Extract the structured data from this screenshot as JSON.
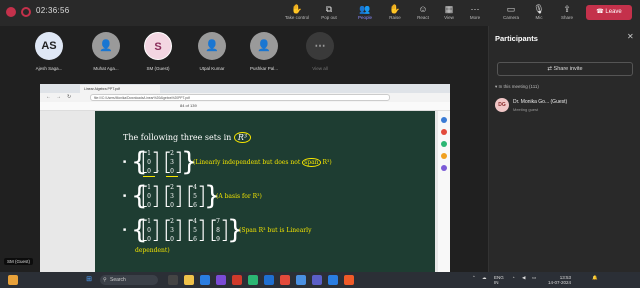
{
  "teams": {
    "timer": "02:36:56",
    "toolbar": [
      {
        "label": "Take control",
        "icon": "hand-icon"
      },
      {
        "label": "Pop out",
        "icon": "pop-out-icon"
      },
      {
        "label": "People",
        "icon": "people-icon"
      },
      {
        "label": "Raise",
        "icon": "raise-hand-icon"
      },
      {
        "label": "React",
        "icon": "react-icon"
      },
      {
        "label": "View",
        "icon": "view-icon"
      },
      {
        "label": "More",
        "icon": "more-icon"
      },
      {
        "label": "Camera",
        "icon": "camera-icon"
      },
      {
        "label": "Mic",
        "icon": "mic-icon"
      },
      {
        "label": "Share",
        "icon": "share-icon"
      }
    ],
    "leave_label": "Leave"
  },
  "participants_strip": [
    {
      "initials": "AS",
      "name": "Ajesh Saga...",
      "color": "#dfe7f5"
    },
    {
      "initials": "",
      "name": "Muhat Aga...",
      "color": "#9a9a9a"
    },
    {
      "initials": "S",
      "name": "SM (Guest)",
      "color": "#f3d6e2"
    },
    {
      "initials": "",
      "name": "Utpal Kumar",
      "color": "#9a9a9a"
    },
    {
      "initials": "",
      "name": "Pushkar Pal...",
      "color": "#9a9a9a"
    },
    {
      "initials": "",
      "name": "View all",
      "color": "#3a3a3a"
    }
  ],
  "panel": {
    "title": "Participants",
    "share_invite": "Share invite",
    "in_meeting": "In this meeting (111)",
    "person": {
      "initials": "DG",
      "name": "Dr. Monika Go...  (Guest)",
      "role": "Meeting guest"
    }
  },
  "browser": {
    "tab_title": "Linear Algebra PPT.pdf",
    "url": "file:///C:/Users/Monika/Downloads/Linear%20Algebra%20PPT.pdf",
    "pdf_info": "84  of 139"
  },
  "slide": {
    "title_text": "The following three sets in",
    "title_space": "R³",
    "rows": [
      {
        "vectors": [
          [
            "1",
            "0",
            "0"
          ],
          [
            "2",
            "3",
            "0"
          ]
        ],
        "caption": "(Linearly independent but does not",
        "caption_hl": "span",
        "caption_end": "R³)"
      },
      {
        "vectors": [
          [
            "1",
            "0",
            "0"
          ],
          [
            "2",
            "3",
            "0"
          ],
          [
            "4",
            "5",
            "6"
          ]
        ],
        "caption": "(A basis for R³)",
        "caption_hl": "",
        "caption_end": ""
      },
      {
        "vectors": [
          [
            "1",
            "0",
            "0"
          ],
          [
            "2",
            "3",
            "0"
          ],
          [
            "4",
            "5",
            "6"
          ],
          [
            "7",
            "8",
            "9"
          ]
        ],
        "caption": "(Span R³ but is Linearly",
        "caption_hl": "",
        "caption_end": "dependent)"
      }
    ]
  },
  "you_label": "SM (Guest)",
  "taskbar": {
    "search": "Search",
    "lang": "ENG",
    "lang2": "IN",
    "time": "13:53",
    "date": "14-07-2024"
  }
}
